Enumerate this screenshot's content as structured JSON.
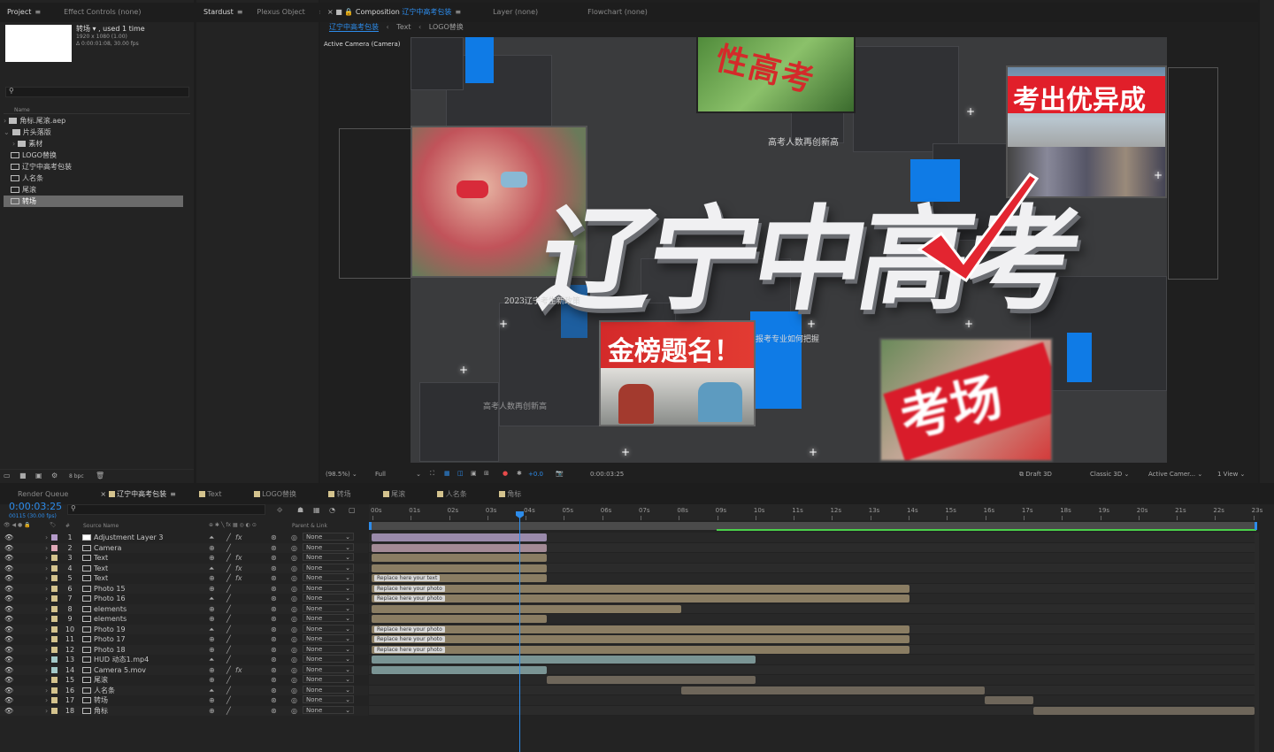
{
  "project_panel": {
    "tabs": [
      "Project",
      "Effect Controls (none)"
    ],
    "selected_name": "转场 ▾ , used 1 time",
    "meta_line1": "1920 x 1080 (1.00)",
    "meta_line2": "Δ 0:00:01:08, 30.00 fps",
    "search_placeholder": "",
    "column_header": "Name",
    "items": [
      {
        "label": "角标.尾滚.aep",
        "type": "folder"
      },
      {
        "label": "片头落版",
        "type": "folder"
      },
      {
        "label": "素材",
        "type": "folder"
      },
      {
        "label": "LOGO替换",
        "type": "comp"
      },
      {
        "label": "辽宁中高考包装",
        "type": "comp"
      },
      {
        "label": "人名条",
        "type": "comp"
      },
      {
        "label": "尾滚",
        "type": "comp"
      },
      {
        "label": "转场",
        "type": "comp"
      }
    ],
    "bpc": "8 bpc"
  },
  "stardust_panel": {
    "tabs": [
      "Stardust",
      "Plexus Object"
    ],
    "overflow": "»"
  },
  "composition_panel": {
    "tab_label": "Composition",
    "comp_name": "辽宁中高考包装",
    "other_tabs": [
      "Layer (none)",
      "Flowchart (none)"
    ],
    "breadcrumb": [
      "辽宁中高考包装",
      "Text",
      "LOGO替换"
    ],
    "camera_label": "Active Camera (Camera)",
    "viewer_overlay": {
      "banner_tl": "性高考",
      "banner_tr": "考出优异成",
      "photo_center_text": "金榜题名！",
      "photo_br_text": "考场",
      "main_title": "辽宁中高考",
      "ghost_texts": [
        "高考人数再创新高",
        "2023辽宁考生新政策",
        "报考专业如何把握",
        "高考人数再创新高"
      ]
    },
    "footer": {
      "zoom": "(98.5%)",
      "resolution": "Full",
      "exposure": "+0.0",
      "timecode": "0:00:03:25",
      "renderer": "Draft 3D",
      "renderer2": "Classic 3D",
      "camera": "Active Camer...",
      "views": "1 View"
    }
  },
  "timeline": {
    "tabs": [
      "Render Queue",
      "辽宁中高考包装",
      "Text",
      "LOGO替换",
      "转场",
      "尾滚",
      "人名条",
      "角标"
    ],
    "timecode": "0:00:03:25",
    "frame_info": "00115 (30.00 fps)",
    "columns": {
      "source": "Source Name",
      "parent": "Parent & Link"
    },
    "ruler": [
      "00s",
      "01s",
      "02s",
      "03s",
      "04s",
      "05s",
      "06s",
      "07s",
      "08s",
      "09s",
      "10s",
      "11s",
      "12s",
      "13s",
      "14s",
      "15s",
      "16s",
      "17s",
      "18s",
      "19s",
      "20s",
      "21s",
      "22s",
      "23s"
    ],
    "layers": [
      {
        "num": "1",
        "name": "Adjustment Layer 3",
        "parent": "None",
        "color": "#b39ac8",
        "fx": "fx"
      },
      {
        "num": "2",
        "name": "Camera",
        "parent": "None",
        "color": "#e0a8b8",
        "fx": ""
      },
      {
        "num": "3",
        "name": "Text",
        "parent": "None",
        "color": "#d4c38e",
        "fx": "fx"
      },
      {
        "num": "4",
        "name": "Text",
        "parent": "None",
        "color": "#d4c38e",
        "fx": "fx"
      },
      {
        "num": "5",
        "name": "Text",
        "parent": "None",
        "color": "#d4c38e",
        "fx": "fx"
      },
      {
        "num": "6",
        "name": "Photo 15",
        "parent": "None",
        "color": "#d4c38e",
        "fx": ""
      },
      {
        "num": "7",
        "name": "Photo 16",
        "parent": "None",
        "color": "#d4c38e",
        "fx": ""
      },
      {
        "num": "8",
        "name": "elements",
        "parent": "None",
        "color": "#d4c38e",
        "fx": ""
      },
      {
        "num": "9",
        "name": "elements",
        "parent": "None",
        "color": "#d4c38e",
        "fx": ""
      },
      {
        "num": "10",
        "name": "Photo 19",
        "parent": "None",
        "color": "#d4c38e",
        "fx": ""
      },
      {
        "num": "11",
        "name": "Photo 17",
        "parent": "None",
        "color": "#d4c38e",
        "fx": ""
      },
      {
        "num": "12",
        "name": "Photo 18",
        "parent": "None",
        "color": "#d4c38e",
        "fx": ""
      },
      {
        "num": "13",
        "name": "HUD 动态1.mp4",
        "parent": "None",
        "color": "#a3c9c9",
        "fx": ""
      },
      {
        "num": "14",
        "name": "Camera 5.mov",
        "parent": "None",
        "color": "#a3c9c9",
        "fx": "fx"
      },
      {
        "num": "15",
        "name": "尾滚",
        "parent": "None",
        "color": "#d4c38e",
        "fx": ""
      },
      {
        "num": "16",
        "name": "人名条",
        "parent": "None",
        "color": "#d4c38e",
        "fx": ""
      },
      {
        "num": "17",
        "name": "转场",
        "parent": "None",
        "color": "#d4c38e",
        "fx": ""
      },
      {
        "num": "18",
        "name": "角标",
        "parent": "None",
        "color": "#d4c38e",
        "fx": ""
      }
    ],
    "bar_tags": {
      "text": "Replace here your text",
      "photo": "Replace here your photo"
    }
  }
}
